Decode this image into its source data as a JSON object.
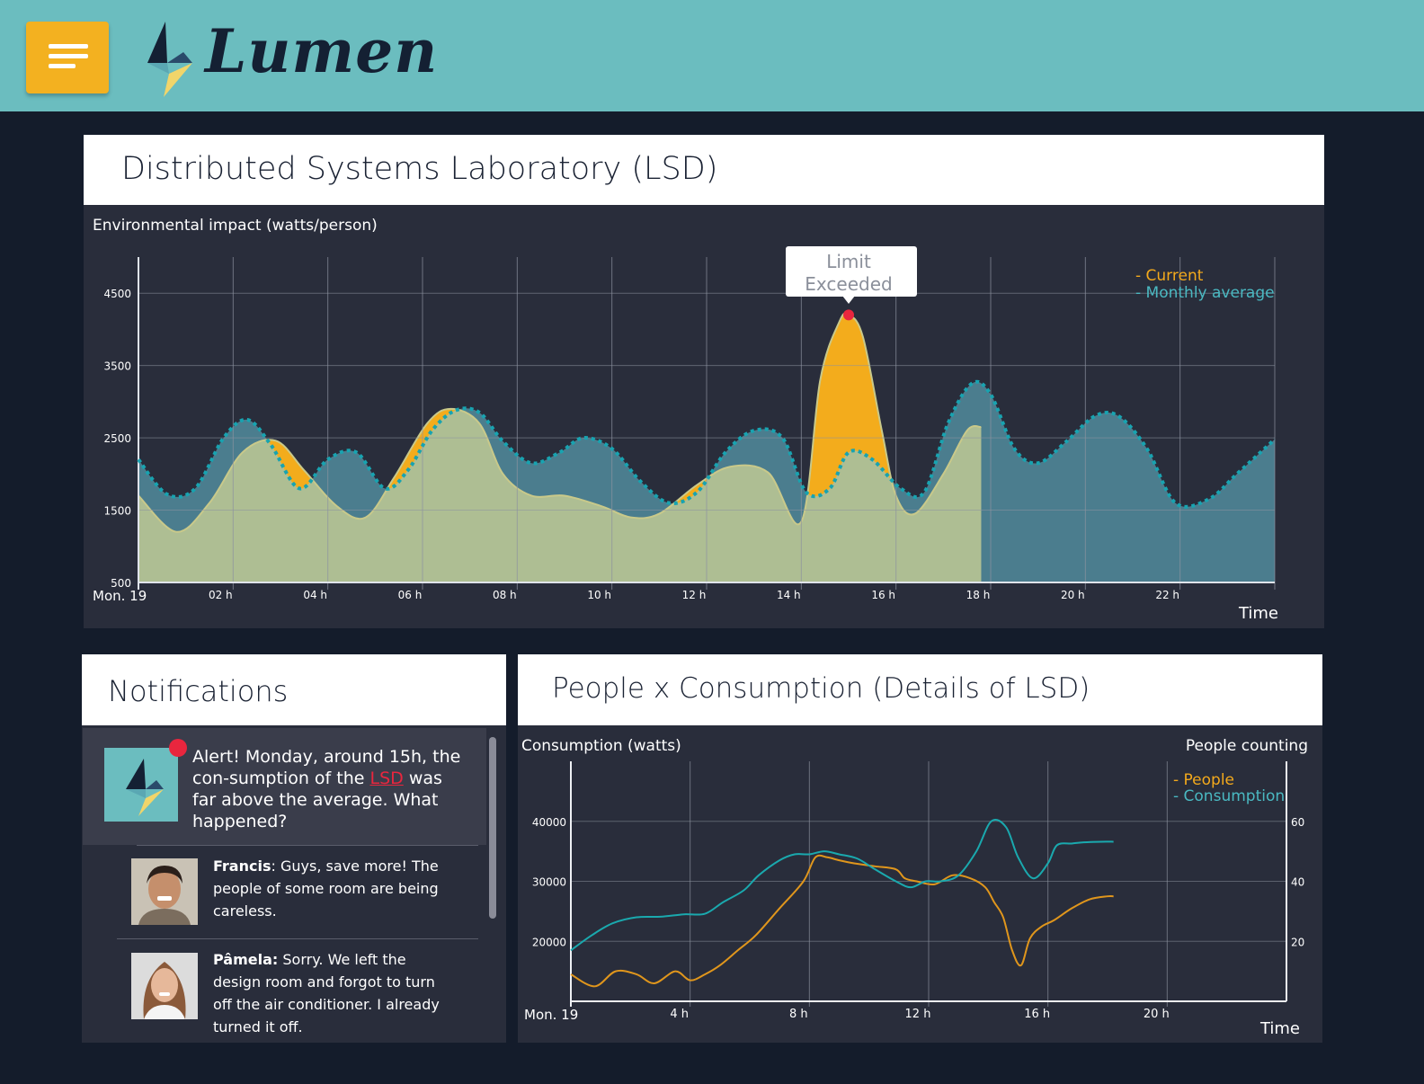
{
  "app": {
    "name": "Lumen",
    "menu_icon": "hamburger-icon",
    "logo_icon": "lightning-bolt-icon"
  },
  "colors": {
    "header": "#6bbdbf",
    "accent": "#f3b120",
    "current": "#f3a91c",
    "average": "#4ab9c2",
    "alert": "#e9263e"
  },
  "main_panel": {
    "title": "Distributed Systems Laboratory (LSD)",
    "tooltip": {
      "line1": "Limit",
      "line2": "Exceeded"
    }
  },
  "notifications": {
    "title": "Notifications",
    "alert": {
      "pre": "Alert! Monday, around 15h, the con-sumption of the ",
      "link": "LSD",
      "post": " was far above the average. What happened?"
    },
    "comments": [
      {
        "author": "Francis",
        "sep": ": ",
        "text": "Guys, save more! The people of some room are being careless."
      },
      {
        "author": "Pâmela:",
        "sep": " ",
        "text": "Sorry. We left the design room and forgot to turn off the air conditioner. I already turned it off."
      }
    ]
  },
  "detail_panel": {
    "title": "People x Consumption (Details of LSD)"
  },
  "chart_data": [
    {
      "type": "area",
      "ylabel": "Environmental impact (watts/person)",
      "xlabel": "Time",
      "x_start_label": "Mon. 19",
      "x_tick_labels": [
        "02 h",
        "04 h",
        "06 h",
        "08 h",
        "10 h",
        "12 h",
        "14 h",
        "16 h",
        "18 h",
        "20 h",
        "22 h"
      ],
      "y_ticks": [
        500,
        1500,
        2500,
        3500,
        4500
      ],
      "ylim": [
        0,
        4500
      ],
      "xlim": [
        0,
        24
      ],
      "grid": true,
      "legend_position": "top-right",
      "series": [
        {
          "name": "- Current",
          "x": [
            0,
            0.8,
            1.5,
            2.2,
            2.9,
            3.5,
            4.2,
            4.8,
            5.4,
            6.1,
            6.6,
            7.2,
            7.7,
            8.3,
            9.0,
            9.8,
            10.4,
            11.0,
            11.8,
            12.5,
            13.3,
            14.0,
            14.4,
            14.8,
            15.0,
            15.3,
            15.7,
            16.0,
            16.4,
            17.0,
            17.5,
            17.8
          ],
          "y": [
            1200,
            700,
            1100,
            1800,
            1960,
            1550,
            1050,
            900,
            1450,
            2200,
            2400,
            2200,
            1500,
            1200,
            1200,
            1050,
            900,
            950,
            1350,
            1600,
            1520,
            840,
            2800,
            3600,
            3700,
            3400,
            2100,
            1200,
            950,
            1500,
            2100,
            2150
          ]
        },
        {
          "name": "- Monthly average",
          "x": [
            0,
            0.6,
            1.2,
            1.8,
            2.3,
            2.8,
            3.4,
            4.0,
            4.6,
            5.2,
            5.7,
            6.2,
            6.7,
            7.2,
            7.7,
            8.3,
            8.9,
            9.4,
            10.0,
            10.6,
            11.2,
            11.8,
            12.4,
            13.0,
            13.6,
            14.1,
            14.6,
            15.0,
            15.5,
            16.1,
            16.6,
            17.1,
            17.6,
            18.0,
            18.5,
            19.0,
            19.6,
            20.2,
            20.7,
            21.3,
            21.9,
            22.6,
            23.2,
            24.0
          ],
          "y": [
            1700,
            1220,
            1300,
            2000,
            2250,
            1900,
            1300,
            1700,
            1800,
            1300,
            1560,
            2100,
            2380,
            2350,
            1950,
            1650,
            1800,
            2000,
            1850,
            1400,
            1100,
            1250,
            1800,
            2100,
            2000,
            1250,
            1300,
            1800,
            1700,
            1300,
            1250,
            2200,
            2750,
            2600,
            1850,
            1650,
            1950,
            2300,
            2300,
            1850,
            1100,
            1150,
            1500,
            1980
          ]
        }
      ],
      "annotation": {
        "x": 15.0,
        "y": 3700,
        "text": "Limit Exceeded"
      }
    },
    {
      "type": "line",
      "ylabel": "Consumption (watts)",
      "y2label": "People counting",
      "xlabel": "Time",
      "x_start_label": "Mon. 19",
      "x_tick_labels": [
        "4 h",
        "8 h",
        "12 h",
        "16 h",
        "20 h"
      ],
      "y_ticks": [
        20000,
        30000,
        40000
      ],
      "y2_ticks": [
        20,
        40,
        60
      ],
      "ylim": [
        10000,
        50000
      ],
      "y2lim": [
        0,
        80
      ],
      "xlim": [
        0,
        24
      ],
      "grid": true,
      "legend_position": "top-right",
      "series": [
        {
          "name": "- People",
          "axis": "right",
          "x": [
            0,
            0.8,
            1.5,
            2.2,
            2.8,
            3.5,
            4.0,
            4.5,
            5.0,
            5.6,
            6.2,
            7.0,
            7.8,
            8.2,
            8.6,
            9.0,
            9.5,
            10.2,
            10.9,
            11.2,
            11.6,
            12.2,
            12.8,
            13.4,
            13.9,
            14.2,
            14.5,
            14.8,
            15.1,
            15.4,
            15.8,
            16.2,
            16.8,
            17.4,
            18.0,
            18.2
          ],
          "y": [
            9,
            5,
            10,
            9,
            6,
            10,
            7,
            9,
            12,
            17,
            22,
            31,
            40,
            48,
            48,
            47,
            46,
            45,
            44,
            41,
            40,
            39,
            42,
            41,
            38,
            33,
            28,
            17,
            12,
            21,
            25,
            27,
            31,
            34,
            35,
            35
          ]
        },
        {
          "name": "- Consumption",
          "axis": "left",
          "x": [
            0,
            0.7,
            1.4,
            2.2,
            3.0,
            3.8,
            4.5,
            5.1,
            5.8,
            6.3,
            7.0,
            7.5,
            8.0,
            8.5,
            9.0,
            9.6,
            10.2,
            10.9,
            11.4,
            11.9,
            12.4,
            13.0,
            13.6,
            14.1,
            14.6,
            15.0,
            15.5,
            16.0,
            16.3,
            16.8,
            17.2,
            17.8,
            18.2
          ],
          "y": [
            18500,
            21000,
            23000,
            24000,
            24100,
            24500,
            24600,
            26500,
            28500,
            31000,
            33500,
            34500,
            34500,
            35000,
            34500,
            33800,
            32000,
            30000,
            29000,
            30000,
            30000,
            31000,
            35000,
            40000,
            39000,
            34000,
            30500,
            33000,
            36000,
            36300,
            36500,
            36600,
            36600
          ]
        }
      ]
    }
  ]
}
